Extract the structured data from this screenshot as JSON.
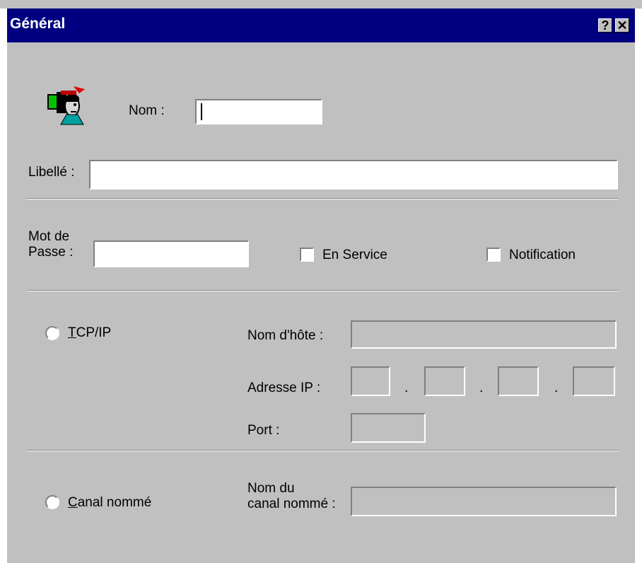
{
  "titlebar": {
    "title": "Général",
    "help": "?",
    "close": "✕"
  },
  "form": {
    "nom_label": "Nom :",
    "nom_value": "",
    "libelle_label": "Libellé :",
    "libelle_value": "",
    "password_label_line1": "Mot de",
    "password_label_line2": "Passe :",
    "password_value": "",
    "en_service_label": "En Service",
    "en_service_checked": false,
    "notification_label": "Notification",
    "notification_checked": false
  },
  "tcpip": {
    "radio_label_mnemonic": "T",
    "radio_label_rest": "CP/IP",
    "selected": false,
    "hostname_label": "Nom d'hôte :",
    "hostname_value": "",
    "ip_label": "Adresse IP :",
    "ip_dot": ".",
    "ip_octets": [
      "",
      "",
      "",
      ""
    ],
    "port_label": "Port :",
    "port_value": ""
  },
  "named_pipe": {
    "radio_label_mnemonic": "C",
    "radio_label_rest": "anal nommé",
    "selected": false,
    "name_label_line1": "Nom du",
    "name_label_line2": "canal nommé :",
    "name_value": ""
  },
  "icons": {
    "user": "user-icon"
  },
  "colors": {
    "titlebar": "#000080",
    "face": "#c0c0c0"
  }
}
